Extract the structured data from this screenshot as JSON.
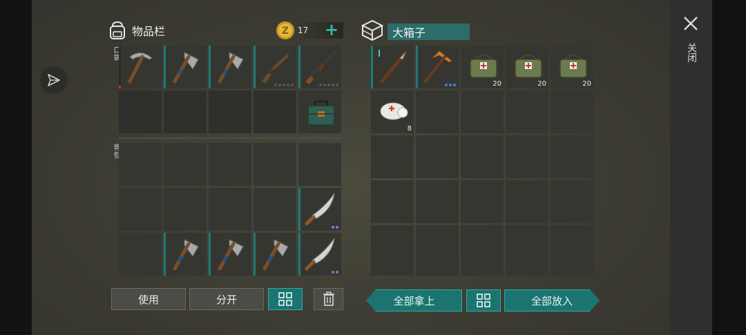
{
  "inventory": {
    "title": "物品栏",
    "coins": "17",
    "pocket_label": "口袋",
    "backpack_label": "背包"
  },
  "container": {
    "title": "大箱子"
  },
  "close": {
    "label": "关闭"
  },
  "buttons": {
    "use": "使用",
    "split": "分开",
    "take_all": "全部拿上",
    "put_all": "全部放入"
  },
  "container_items": {
    "medkit_1": "20",
    "medkit_2": "20",
    "medkit_3": "20",
    "bandage": "8"
  },
  "colors": {
    "accent": "#1c7471",
    "accent_light": "#34b9ae",
    "durability_low": "#c0392b",
    "rarity_blue": "#3d7fd9",
    "rarity_purple": "#9b6bd8"
  }
}
